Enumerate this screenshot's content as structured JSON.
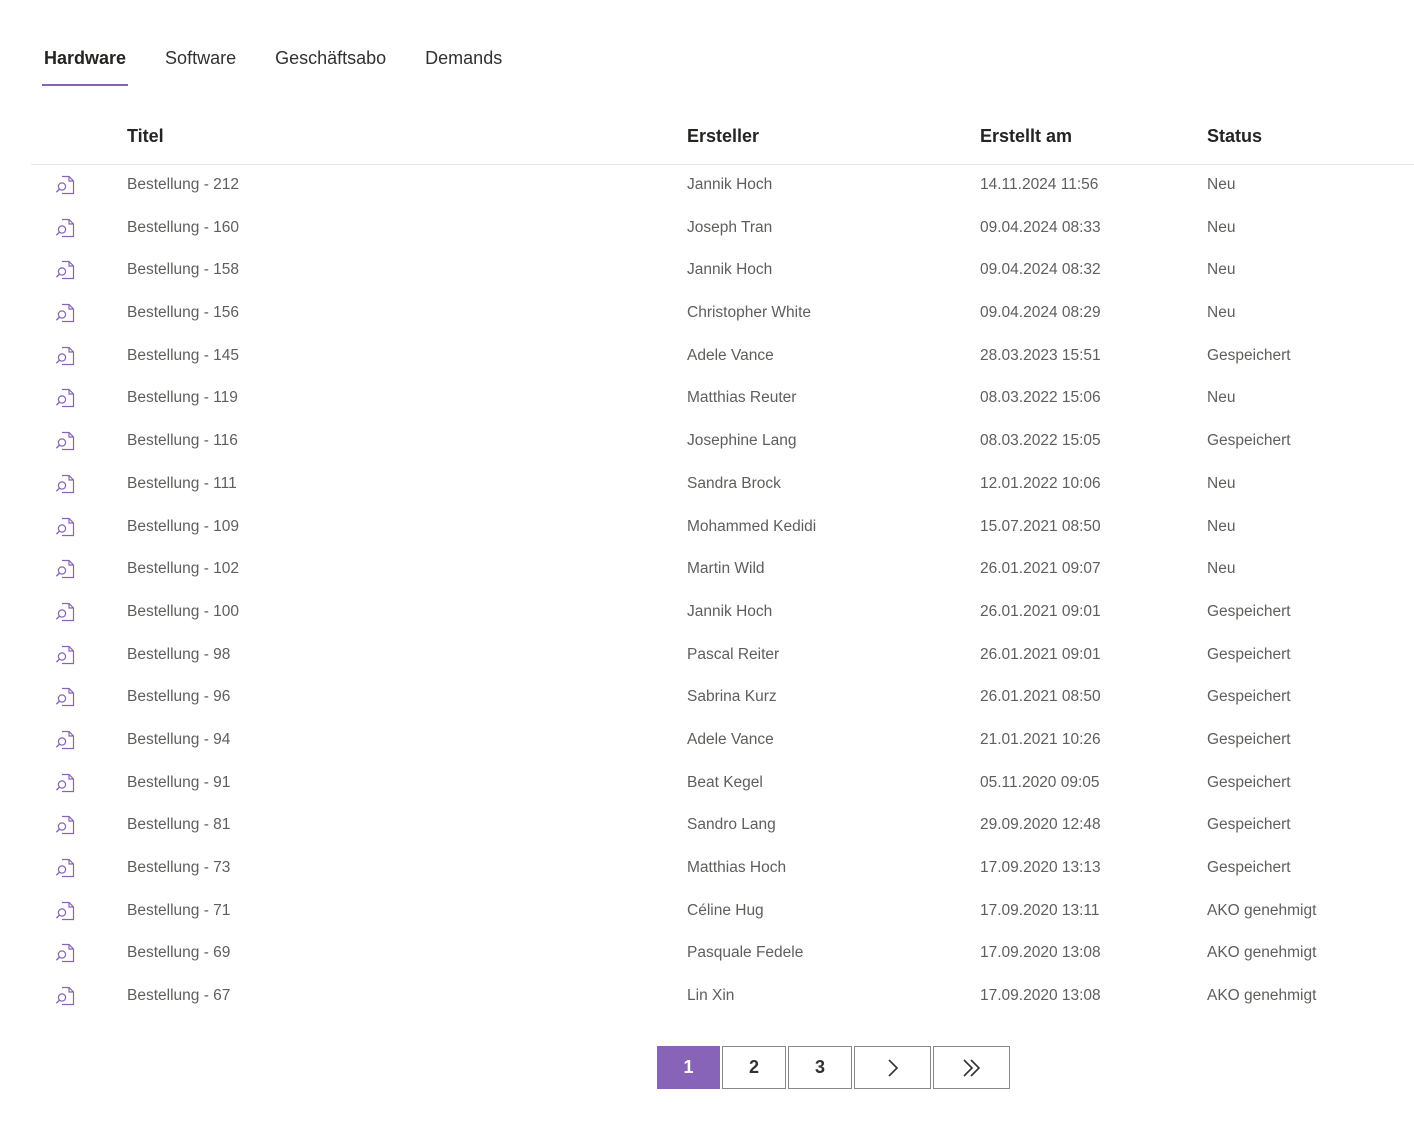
{
  "tabs": [
    {
      "label": "Hardware",
      "active": true
    },
    {
      "label": "Software",
      "active": false
    },
    {
      "label": "Geschäftsabo",
      "active": false
    },
    {
      "label": "Demands",
      "active": false
    }
  ],
  "table": {
    "columns": {
      "title": "Titel",
      "author": "Ersteller",
      "created": "Erstellt am",
      "status": "Status"
    },
    "row_icon": "document-search-icon",
    "rows": [
      {
        "title": "Bestellung - 212",
        "author": "Jannik Hoch",
        "created": "14.11.2024 11:56",
        "status": "Neu"
      },
      {
        "title": "Bestellung - 160",
        "author": "Joseph Tran",
        "created": "09.04.2024 08:33",
        "status": "Neu"
      },
      {
        "title": "Bestellung - 158",
        "author": "Jannik Hoch",
        "created": "09.04.2024 08:32",
        "status": "Neu"
      },
      {
        "title": "Bestellung - 156",
        "author": "Christopher White",
        "created": "09.04.2024 08:29",
        "status": "Neu"
      },
      {
        "title": "Bestellung - 145",
        "author": "Adele Vance",
        "created": "28.03.2023 15:51",
        "status": "Gespeichert"
      },
      {
        "title": "Bestellung - 119",
        "author": "Matthias Reuter",
        "created": "08.03.2022 15:06",
        "status": "Neu"
      },
      {
        "title": "Bestellung - 116",
        "author": "Josephine Lang",
        "created": "08.03.2022 15:05",
        "status": "Gespeichert"
      },
      {
        "title": "Bestellung - 111",
        "author": "Sandra Brock",
        "created": "12.01.2022 10:06",
        "status": "Neu"
      },
      {
        "title": "Bestellung - 109",
        "author": "Mohammed Kedidi",
        "created": "15.07.2021 08:50",
        "status": "Neu"
      },
      {
        "title": "Bestellung - 102",
        "author": "Martin Wild",
        "created": "26.01.2021 09:07",
        "status": "Neu"
      },
      {
        "title": "Bestellung - 100",
        "author": "Jannik Hoch",
        "created": "26.01.2021 09:01",
        "status": "Gespeichert"
      },
      {
        "title": "Bestellung - 98",
        "author": "Pascal Reiter",
        "created": "26.01.2021 09:01",
        "status": "Gespeichert"
      },
      {
        "title": "Bestellung - 96",
        "author": "Sabrina Kurz",
        "created": "26.01.2021 08:50",
        "status": "Gespeichert"
      },
      {
        "title": "Bestellung - 94",
        "author": "Adele Vance",
        "created": "21.01.2021 10:26",
        "status": "Gespeichert"
      },
      {
        "title": "Bestellung - 91",
        "author": "Beat Kegel",
        "created": "05.11.2020 09:05",
        "status": "Gespeichert"
      },
      {
        "title": "Bestellung - 81",
        "author": "Sandro Lang",
        "created": "29.09.2020 12:48",
        "status": "Gespeichert"
      },
      {
        "title": "Bestellung - 73",
        "author": "Matthias Hoch",
        "created": "17.09.2020 13:13",
        "status": "Gespeichert"
      },
      {
        "title": "Bestellung - 71",
        "author": "Céline Hug",
        "created": "17.09.2020 13:11",
        "status": "AKO genehmigt"
      },
      {
        "title": "Bestellung - 69",
        "author": "Pasquale Fedele",
        "created": "17.09.2020 13:08",
        "status": "AKO genehmigt"
      },
      {
        "title": "Bestellung - 67",
        "author": "Lin Xin",
        "created": "17.09.2020 13:08",
        "status": "AKO genehmigt"
      }
    ]
  },
  "pagination": {
    "pages": [
      "1",
      "2",
      "3"
    ],
    "current": "1",
    "next_icon": "chevron-right-icon",
    "last_icon": "double-chevron-right-icon"
  },
  "colors": {
    "accent": "#8764b8",
    "text": "#323130",
    "muted_text": "#605e5c"
  }
}
